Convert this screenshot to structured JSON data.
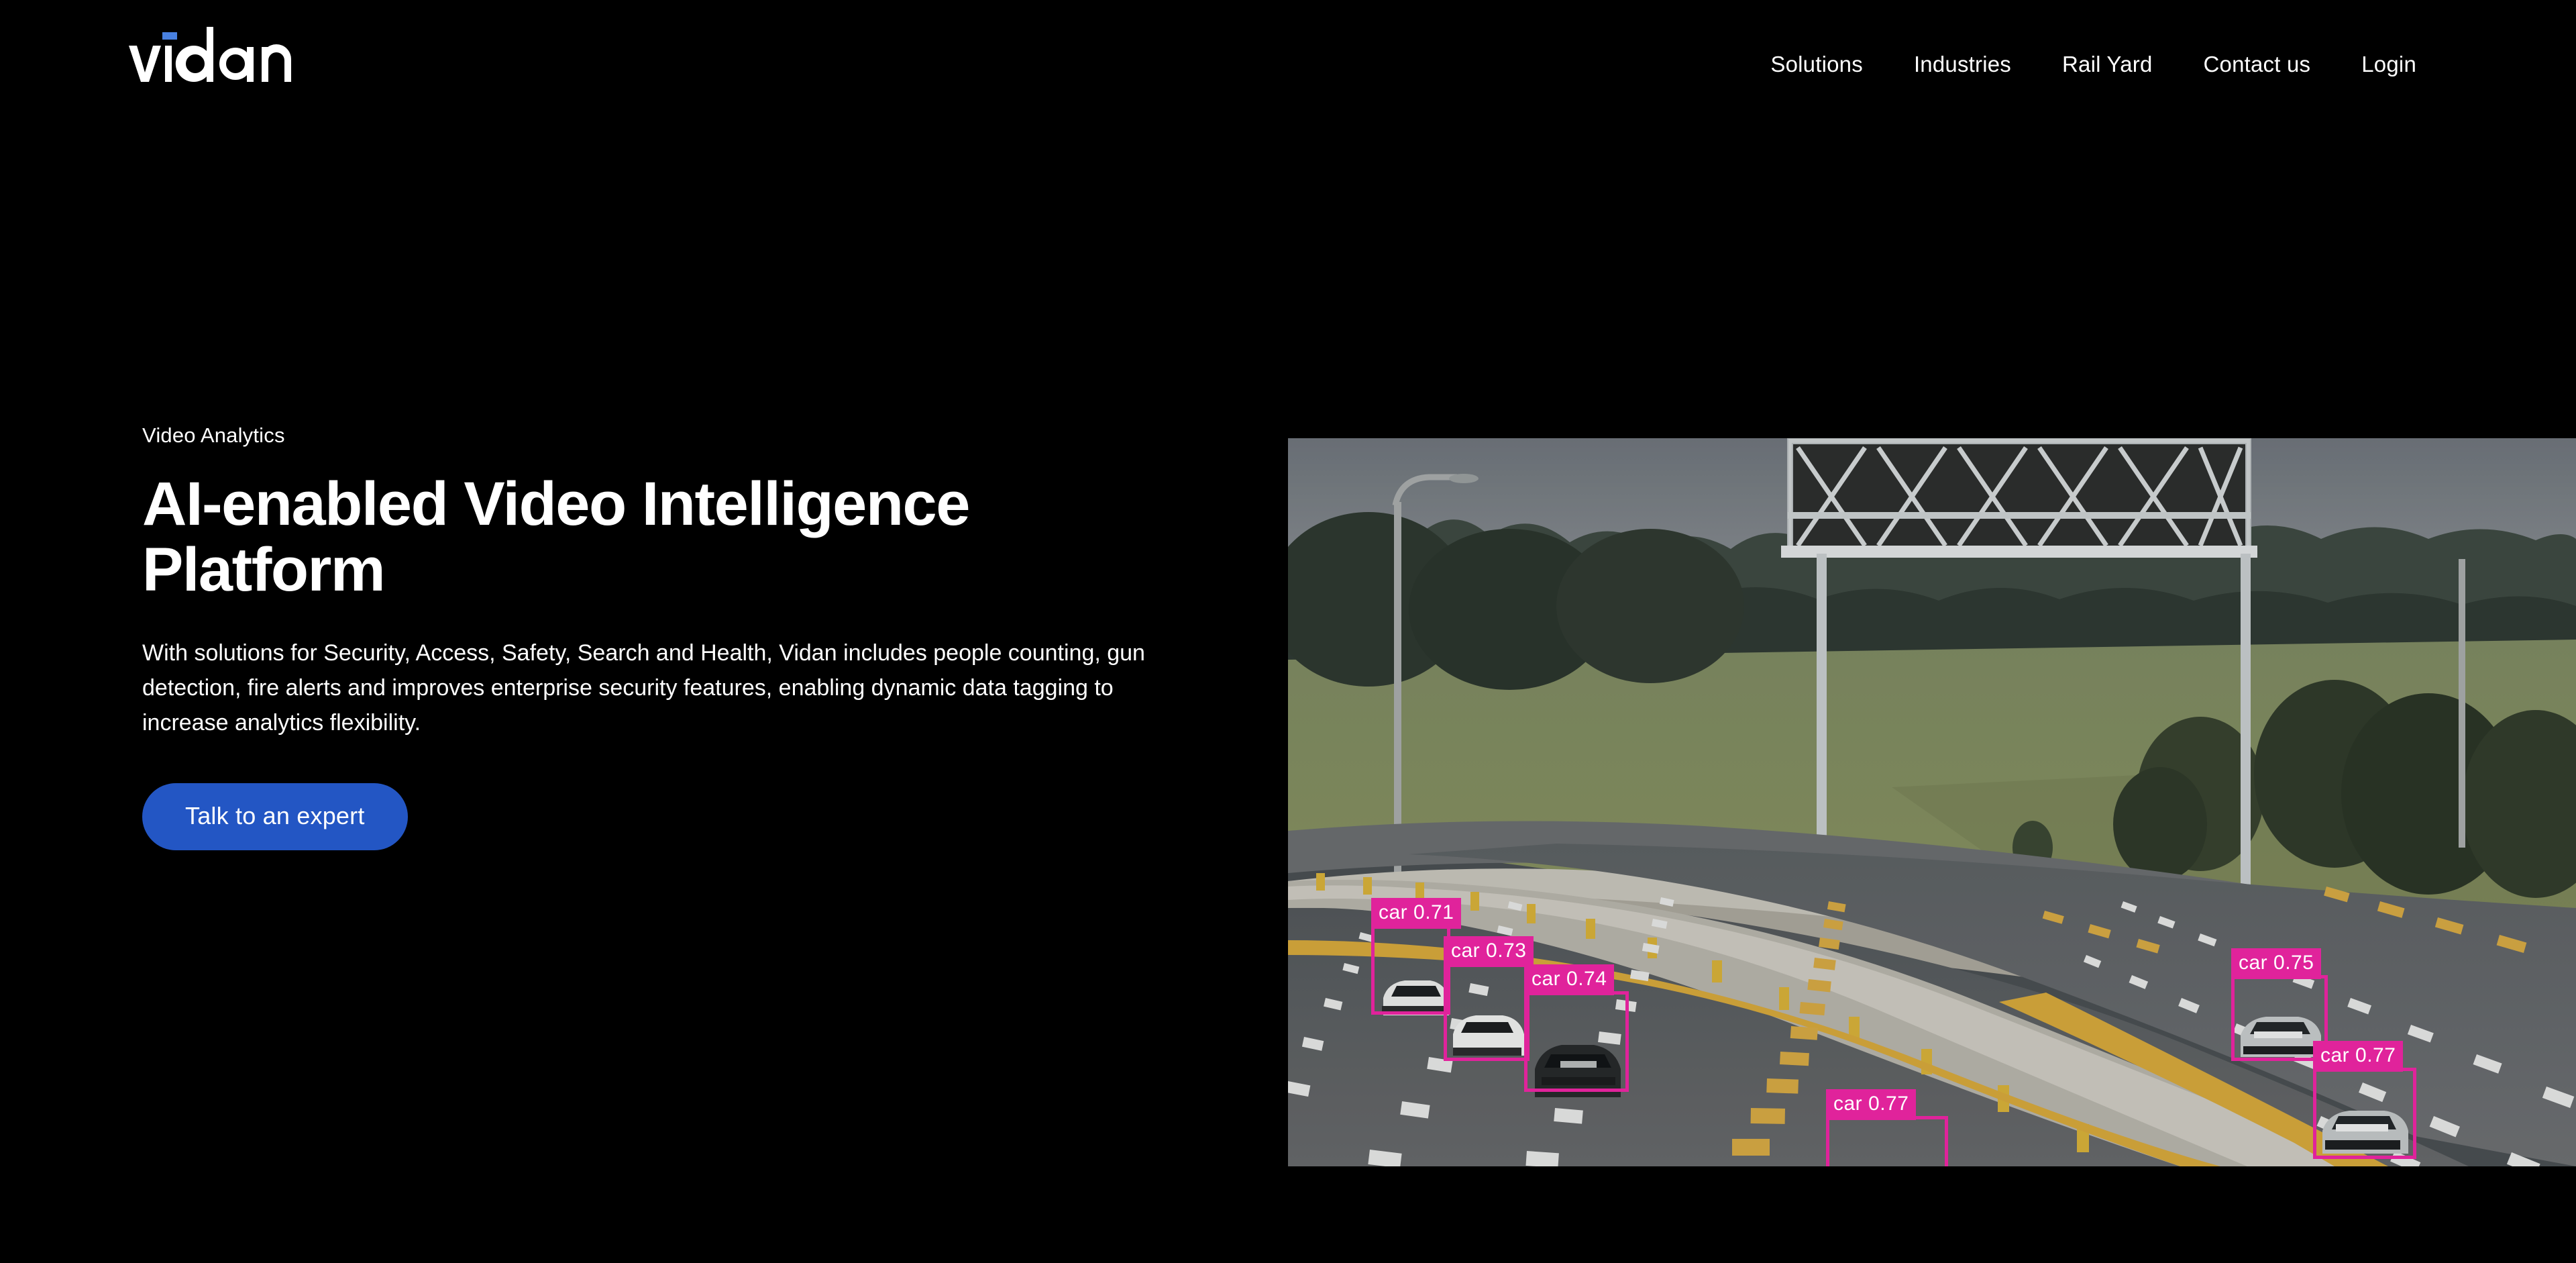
{
  "header": {
    "logo": {
      "text": "vidan",
      "accent_color": "#4880e0",
      "text_color": "#ffffff"
    },
    "nav": [
      {
        "label": "Solutions"
      },
      {
        "label": "Industries"
      },
      {
        "label": "Rail Yard"
      },
      {
        "label": "Contact us"
      },
      {
        "label": "Login"
      }
    ]
  },
  "hero": {
    "eyebrow": "Video Analytics",
    "title": "AI-enabled Video Intelligence Platform",
    "description": "With solutions for Security, Access, Safety, Search and Health, Vidan includes people counting, gun detection, fire alerts and improves enterprise security features, enabling dynamic data tagging to increase analytics flexibility.",
    "cta_label": "Talk to an expert",
    "cta_color": "#2356c4"
  },
  "video": {
    "scene_description": "Aerial traffic camera view of a curving multi-lane highway with overhead sign gantry, concrete median barrier, grass field and trees under overcast sky",
    "detection_color": "#e0239b",
    "detection_label_text_color": "#ffffff",
    "detections": [
      {
        "label": "car 0.71",
        "class": "car",
        "confidence": "0.71"
      },
      {
        "label": "car 0.73",
        "class": "car",
        "confidence": "0.73"
      },
      {
        "label": "car 0.74",
        "class": "car",
        "confidence": "0.74"
      },
      {
        "label": "car 0.75",
        "class": "car",
        "confidence": "0.75"
      },
      {
        "label": "car 0.77",
        "class": "car",
        "confidence": "0.77"
      },
      {
        "label": "car 0.77",
        "class": "car",
        "confidence": "0.77"
      }
    ]
  }
}
